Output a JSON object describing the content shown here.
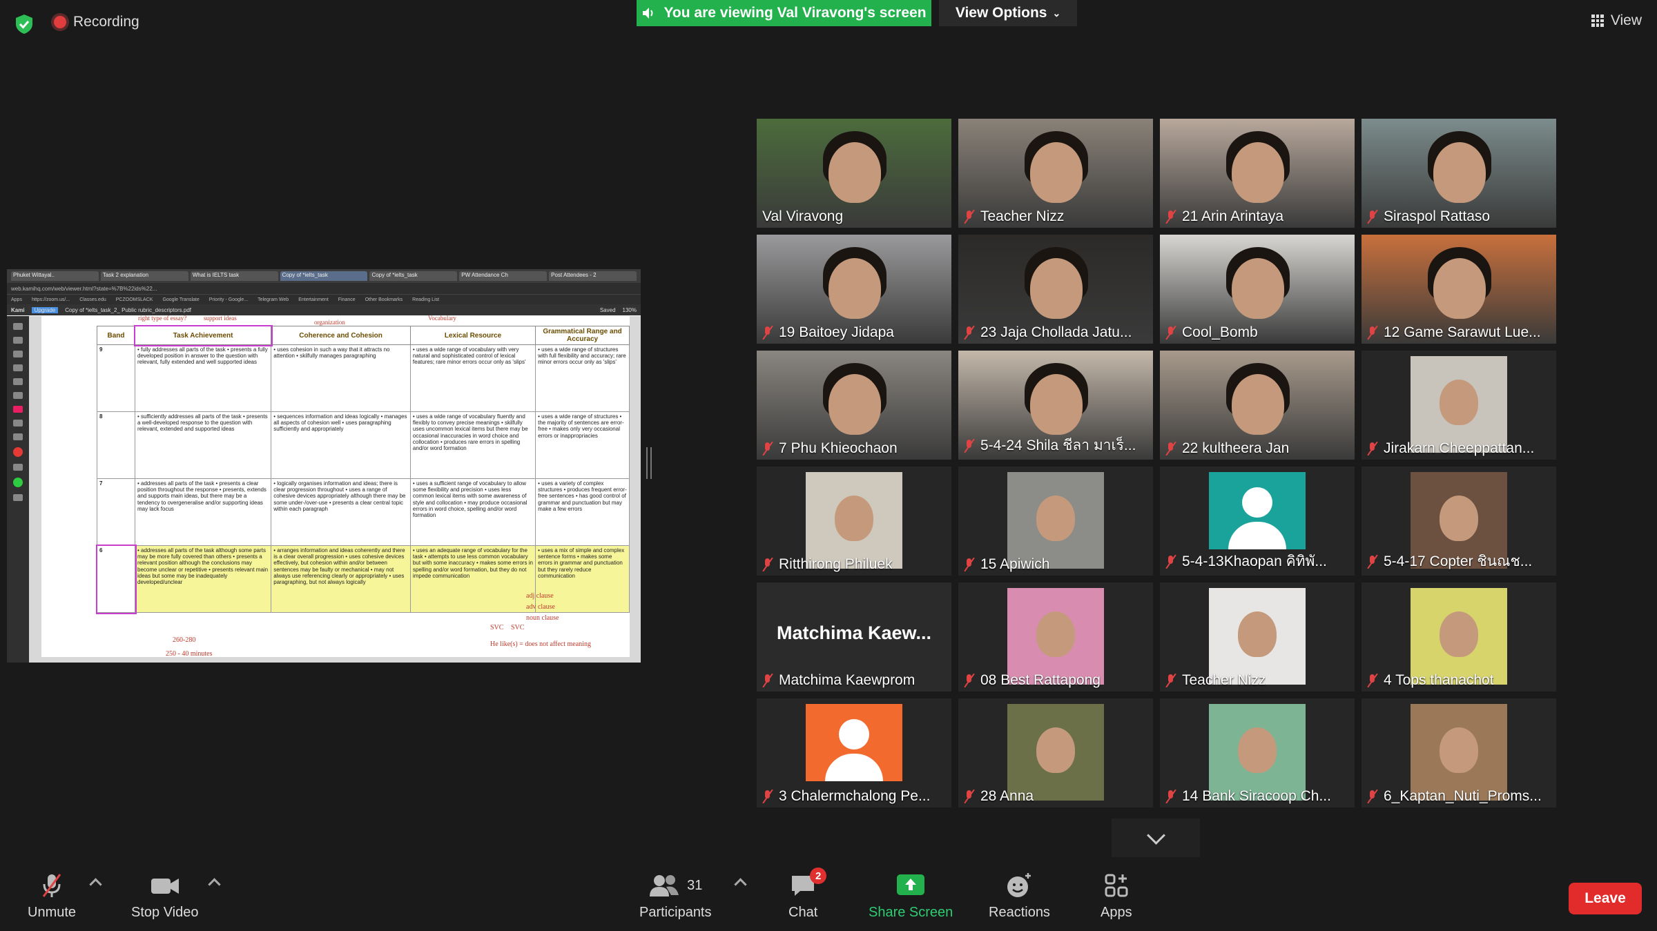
{
  "topbar": {
    "recording_label": "Recording",
    "viewing_label": "You are viewing Val Viravong's screen",
    "view_options_label": "View Options",
    "view_label": "View"
  },
  "shared_screen": {
    "tabs": [
      "Phuket Wittayal..",
      "Task 2 explanation",
      "What is IELTS task",
      "Copy of *ielts_task",
      "Copy of *ielts_task",
      "PW Attendance Ch",
      "Post Attendees - 2"
    ],
    "url": "web.kamihq.com/web/viewer.html?state=%7B%22ids%22...",
    "bookmarks": [
      "Apps",
      "https://zoom.us/...",
      "Classes.edu",
      "PCZOOMSLACK",
      "Google Translate",
      "Priority - Google...",
      "Telegram Web",
      "Entertainment",
      "Finance",
      "Other Bookmarks",
      "Reading List"
    ],
    "kami_label": "Kami",
    "upgrade_label": "Upgrade",
    "doc_title": "Copy of *ielts_task_2_ Public rubric_descriptors.pdf",
    "saved_label": "Saved",
    "zoom": "130%",
    "annotations_top": [
      "right type of essay?",
      "support ideas",
      "organization",
      "Vocabulary"
    ],
    "rubric": {
      "headers": [
        "Band",
        "Task Achievement",
        "Coherence and Cohesion",
        "Lexical Resource",
        "Grammatical Range and Accuracy"
      ],
      "rows": [
        {
          "band": "9",
          "ta": "• fully addresses all parts of the task • presents a fully developed position in answer to the question with relevant, fully extended and well supported ideas",
          "cc": "• uses cohesion in such a way that it attracts no attention • skilfully manages paragraphing",
          "lr": "• uses a wide range of vocabulary with very natural and sophisticated control of lexical features; rare minor errors occur only as 'slips'",
          "gra": "• uses a wide range of structures with full flexibility and accuracy; rare minor errors occur only as 'slips'"
        },
        {
          "band": "8",
          "ta": "• sufficiently addresses all parts of the task • presents a well-developed response to the question with relevant, extended and supported ideas",
          "cc": "• sequences information and ideas logically • manages all aspects of cohesion well • uses paragraphing sufficiently and appropriately",
          "lr": "• uses a wide range of vocabulary fluently and flexibly to convey precise meanings • skilfully uses uncommon lexical items but there may be occasional inaccuracies in word choice and collocation • produces rare errors in spelling and/or word formation",
          "gra": "• uses a wide range of structures • the majority of sentences are error-free • makes only very occasional errors or inappropriacies"
        },
        {
          "band": "7",
          "ta": "• addresses all parts of the task • presents a clear position throughout the response • presents, extends and supports main ideas, but there may be a tendency to overgeneralise and/or supporting ideas may lack focus",
          "cc": "• logically organises information and ideas; there is clear progression throughout • uses a range of cohesive devices appropriately although there may be some under-/over-use • presents a clear central topic within each paragraph",
          "lr": "• uses a sufficient range of vocabulary to allow some flexibility and precision • uses less common lexical items with some awareness of style and collocation • may produce occasional errors in word choice, spelling and/or word formation",
          "gra": "• uses a variety of complex structures • produces frequent error-free sentences • has good control of grammar and punctuation but may make a few errors"
        },
        {
          "band": "6",
          "ta": "• addresses all parts of the task although some parts may be more fully covered than others • presents a relevant position although the conclusions may become unclear or repetitive • presents relevant main ideas but some may be inadequately developed/unclear",
          "cc": "• arranges information and ideas coherently and there is a clear overall progression • uses cohesive devices effectively, but cohesion within and/or between sentences may be faulty or mechanical • may not always use referencing clearly or appropriately • uses paragraphing, but not always logically",
          "lr": "• uses an adequate range of vocabulary for the task • attempts to use less common vocabulary but with some inaccuracy • makes some errors in spelling and/or word formation, but they do not impede communication",
          "gra": "• uses a mix of simple and complex sentence forms • makes some errors in grammar and punctuation but they rarely reduce communication"
        }
      ],
      "handwritten": [
        "adj clause",
        "adv clause",
        "noun clause",
        "SVC",
        "SVC",
        "He like(s) = does not affect meaning",
        "260-280",
        "250 - 40 minutes"
      ]
    }
  },
  "participants_grid": [
    {
      "name": "Val Viravong",
      "muted": false,
      "active": true,
      "kind": "video",
      "bg": "#4c6c3c"
    },
    {
      "name": "Teacher Nizz",
      "muted": true,
      "kind": "video",
      "bg": "#8a8278"
    },
    {
      "name": "21 Arin Arintaya",
      "muted": true,
      "kind": "video",
      "bg": "#b8a89c"
    },
    {
      "name": "Siraspol Rattaso",
      "muted": true,
      "kind": "video",
      "bg": "#7c8c8c"
    },
    {
      "name": "19 Baitoey Jidapa",
      "muted": true,
      "kind": "video",
      "bg": "#9a9a9c"
    },
    {
      "name": "23 Jaja Chollada Jatu...",
      "muted": true,
      "kind": "video",
      "bg": "#2c2a28"
    },
    {
      "name": "Cool_Bomb",
      "muted": true,
      "kind": "video",
      "bg": "#d8d6d2"
    },
    {
      "name": "12 Game Sarawut Lue...",
      "muted": true,
      "kind": "video",
      "bg": "#c8703c"
    },
    {
      "name": "7 Phu Khieochaon",
      "muted": true,
      "kind": "video",
      "bg": "#8a8680"
    },
    {
      "name": "5-4-24 Shila ชีลา มาเร็...",
      "muted": true,
      "kind": "video",
      "bg": "#c4b8aa"
    },
    {
      "name": "22 kultheera Jan",
      "muted": true,
      "kind": "video",
      "bg": "#a89a8c"
    },
    {
      "name": "Jirakarn Cheeppattan...",
      "muted": true,
      "kind": "photo",
      "bg": "#c8c4bc"
    },
    {
      "name": "Ritthirong Philuek",
      "muted": true,
      "kind": "photo",
      "bg": "#cfc9bd"
    },
    {
      "name": "15 Apiwich",
      "muted": true,
      "kind": "photo",
      "bg": "#8c8c88"
    },
    {
      "name": "5-4-13Khaopan คิทิพั...",
      "muted": true,
      "kind": "avatar",
      "bg": "#1aa39a"
    },
    {
      "name": "5-4-17 Copter ชินณช...",
      "muted": true,
      "kind": "photo",
      "bg": "#6c5040"
    },
    {
      "name": "Matchima Kaewprom",
      "card": "Matchima Kaew...",
      "muted": true,
      "kind": "namecard",
      "bg": "#2b2b2b"
    },
    {
      "name": "08 Best Rattapong",
      "muted": true,
      "kind": "photo",
      "bg": "#d88cb0"
    },
    {
      "name": "Teacher Nizz",
      "muted": true,
      "kind": "photo",
      "bg": "#e8e6e4"
    },
    {
      "name": "4 Tops thanachot",
      "muted": true,
      "kind": "photo",
      "bg": "#d8d46c"
    },
    {
      "name": "3 Chalermchalong Pe...",
      "muted": true,
      "kind": "avatar",
      "bg": "#f26a2e"
    },
    {
      "name": "28 Anna",
      "muted": true,
      "kind": "photo",
      "bg": "#6c7048"
    },
    {
      "name": "14 Bank Siracoop Ch...",
      "muted": true,
      "kind": "photo",
      "bg": "#7cb494"
    },
    {
      "name": "6_Kaptan_Nuti_Proms...",
      "muted": true,
      "kind": "photo",
      "bg": "#9a7858"
    }
  ],
  "toolbar": {
    "unmute": "Unmute",
    "stop_video": "Stop Video",
    "participants": "Participants",
    "participants_count": "31",
    "chat": "Chat",
    "chat_badge": "2",
    "share_screen": "Share Screen",
    "reactions": "Reactions",
    "apps": "Apps",
    "leave": "Leave"
  },
  "colors": {
    "green": "#23b14d",
    "leave": "#e22b2b",
    "active_speaker": "#d7e84b",
    "muted_icon": "#e04343"
  }
}
